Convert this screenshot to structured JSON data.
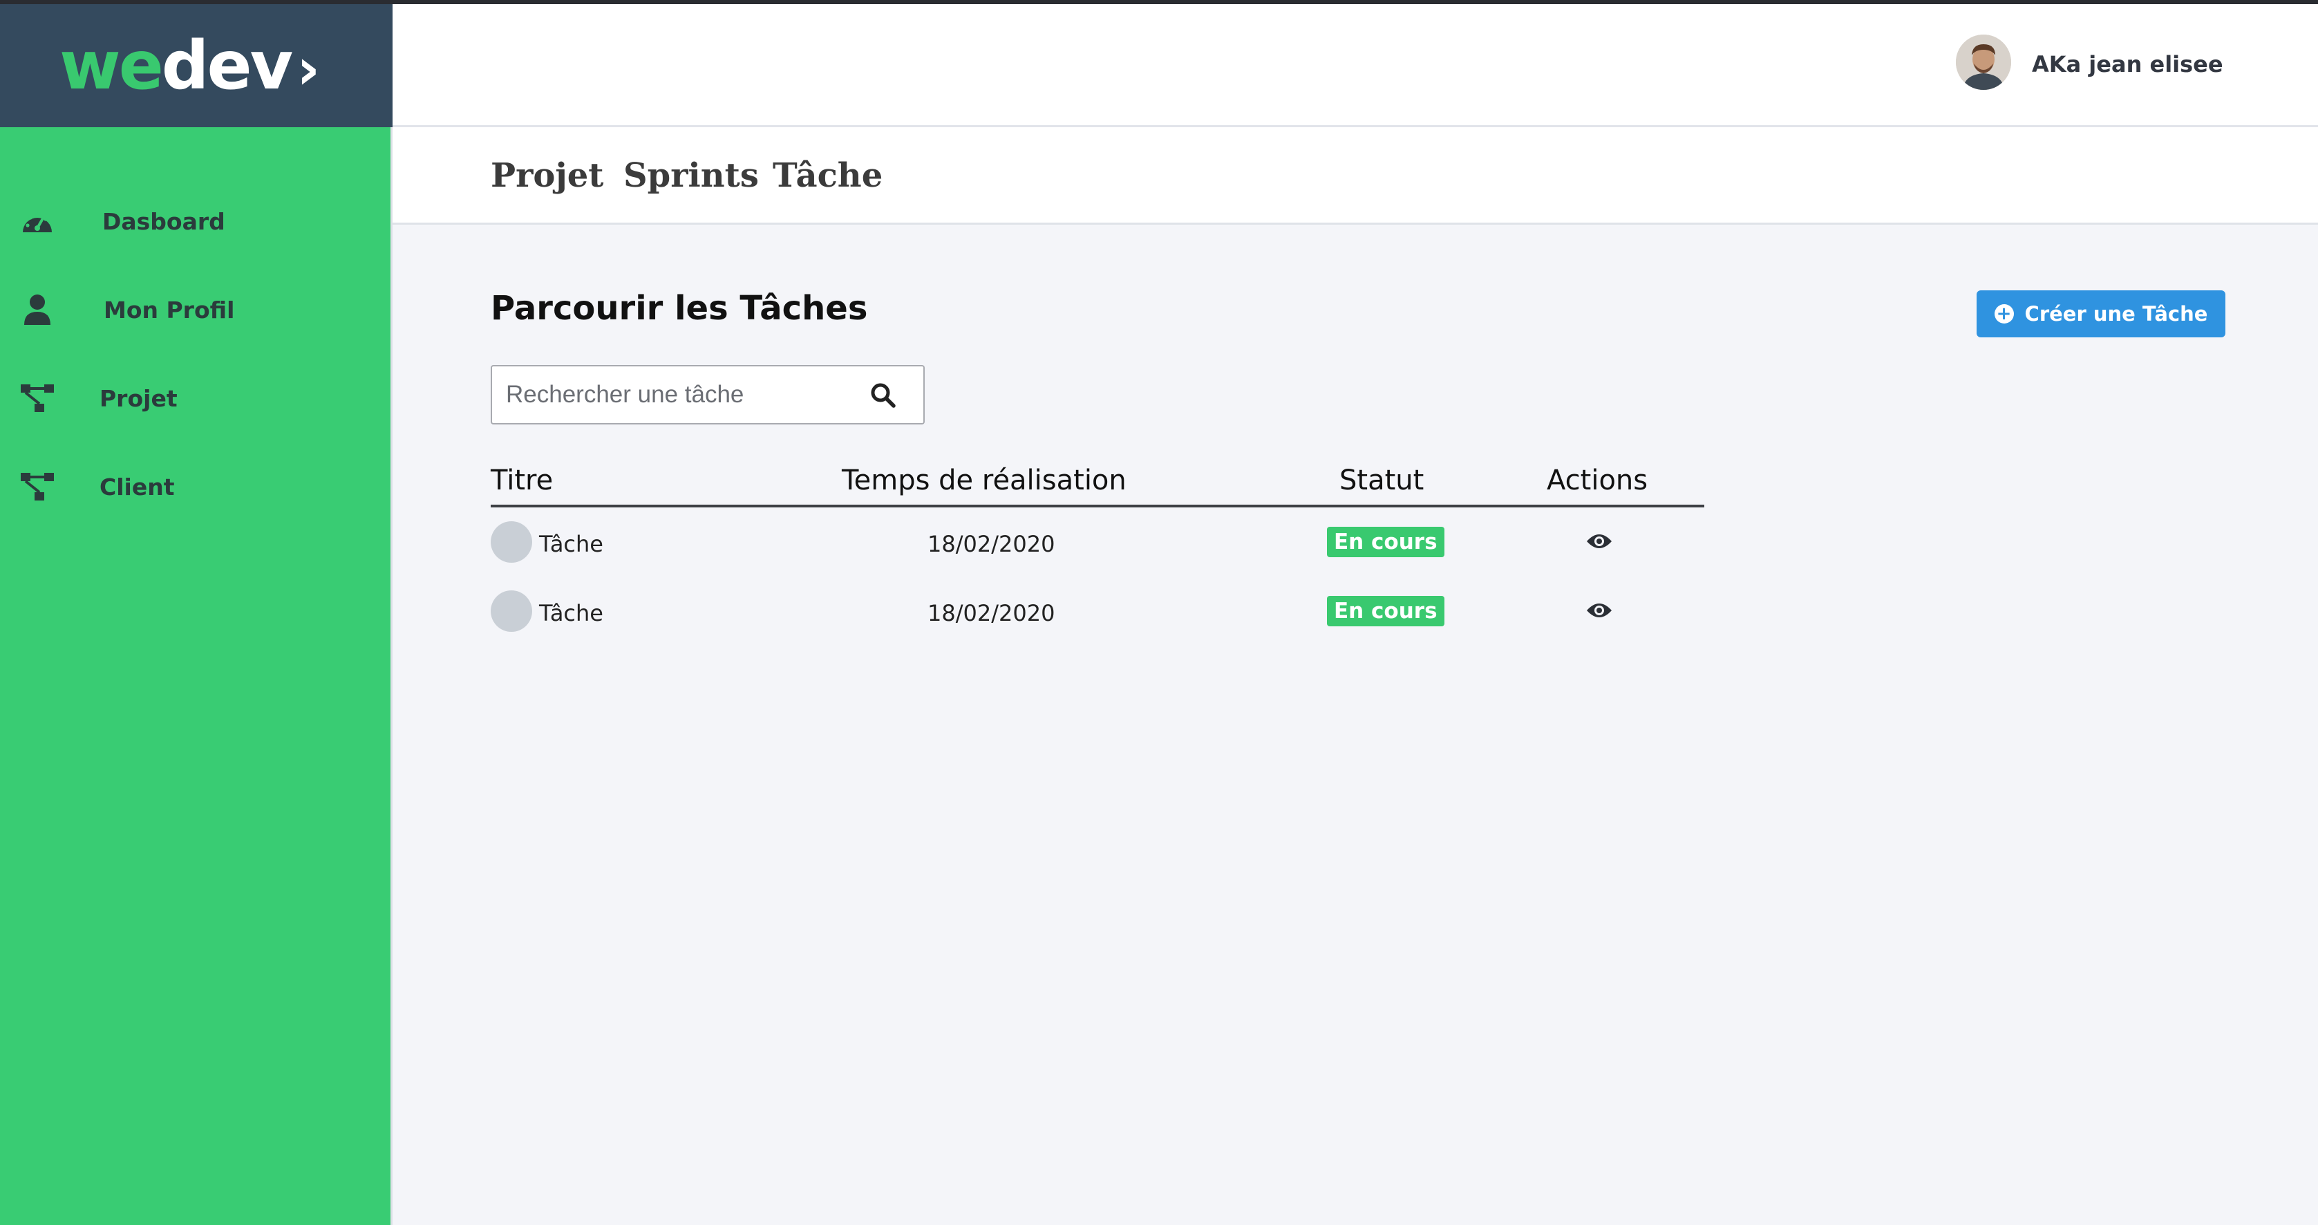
{
  "brand": {
    "we": "we",
    "dev": "dev",
    "chevron": "›"
  },
  "sidebar": {
    "items": [
      {
        "label": "Dasboard",
        "icon": "dashboard-gauge-icon"
      },
      {
        "label": "Mon Profil",
        "icon": "user-icon"
      },
      {
        "label": "Projet",
        "icon": "sitemap-icon"
      },
      {
        "label": "Client",
        "icon": "sitemap-icon"
      }
    ]
  },
  "header": {
    "username": "AKa jean elisee"
  },
  "tabs": [
    "Projet",
    "Sprints",
    "Tâche"
  ],
  "main": {
    "title": "Parcourir les Tâches",
    "create_button": "Créer une Tâche",
    "search_placeholder": "Rechercher une tâche",
    "columns": [
      "Titre",
      "Temps de réalisation",
      "Statut",
      "Actions"
    ],
    "rows": [
      {
        "title": "Tâche",
        "date": "18/02/2020",
        "status": "En cours"
      },
      {
        "title": "Tâche",
        "date": "18/02/2020",
        "status": "En cours"
      }
    ]
  },
  "colors": {
    "sidebar": "#39cc73",
    "logo_bg": "#344a5e",
    "accent": "#2f93e0",
    "badge": "#39c96f"
  }
}
